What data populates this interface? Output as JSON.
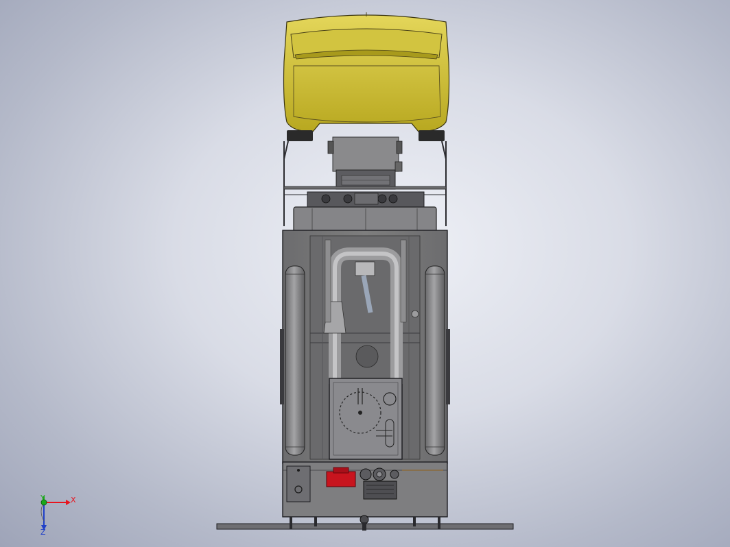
{
  "view": {
    "background_colors": [
      "#eef0f6",
      "#d9dce6",
      "#9ea4b8"
    ]
  },
  "model": {
    "colors": {
      "body_fill": "#7a7a78",
      "body_dark": "#4d4e50",
      "outline": "#2c2c30",
      "seat_yellow": "#c4b52a",
      "seat_highlight": "#ddd050",
      "tank_fill": "#8a8a8c",
      "pipe_fill": "#a8a8aa",
      "red_part": "#c8141e",
      "panel_fill": "#85858a"
    },
    "components": [
      "seat",
      "seat-mount",
      "motor-unit",
      "upper-frame",
      "control-manifold",
      "left-tank",
      "right-tank",
      "intake-pipe",
      "dial-panel",
      "electrical-box",
      "red-component",
      "fan-unit",
      "spreader-bar"
    ]
  },
  "triad": {
    "x_label": "X",
    "y_label": "Y",
    "z_label": "Z",
    "x_color": "#e8141e",
    "y_color": "#18a818",
    "z_color": "#2040c8"
  }
}
